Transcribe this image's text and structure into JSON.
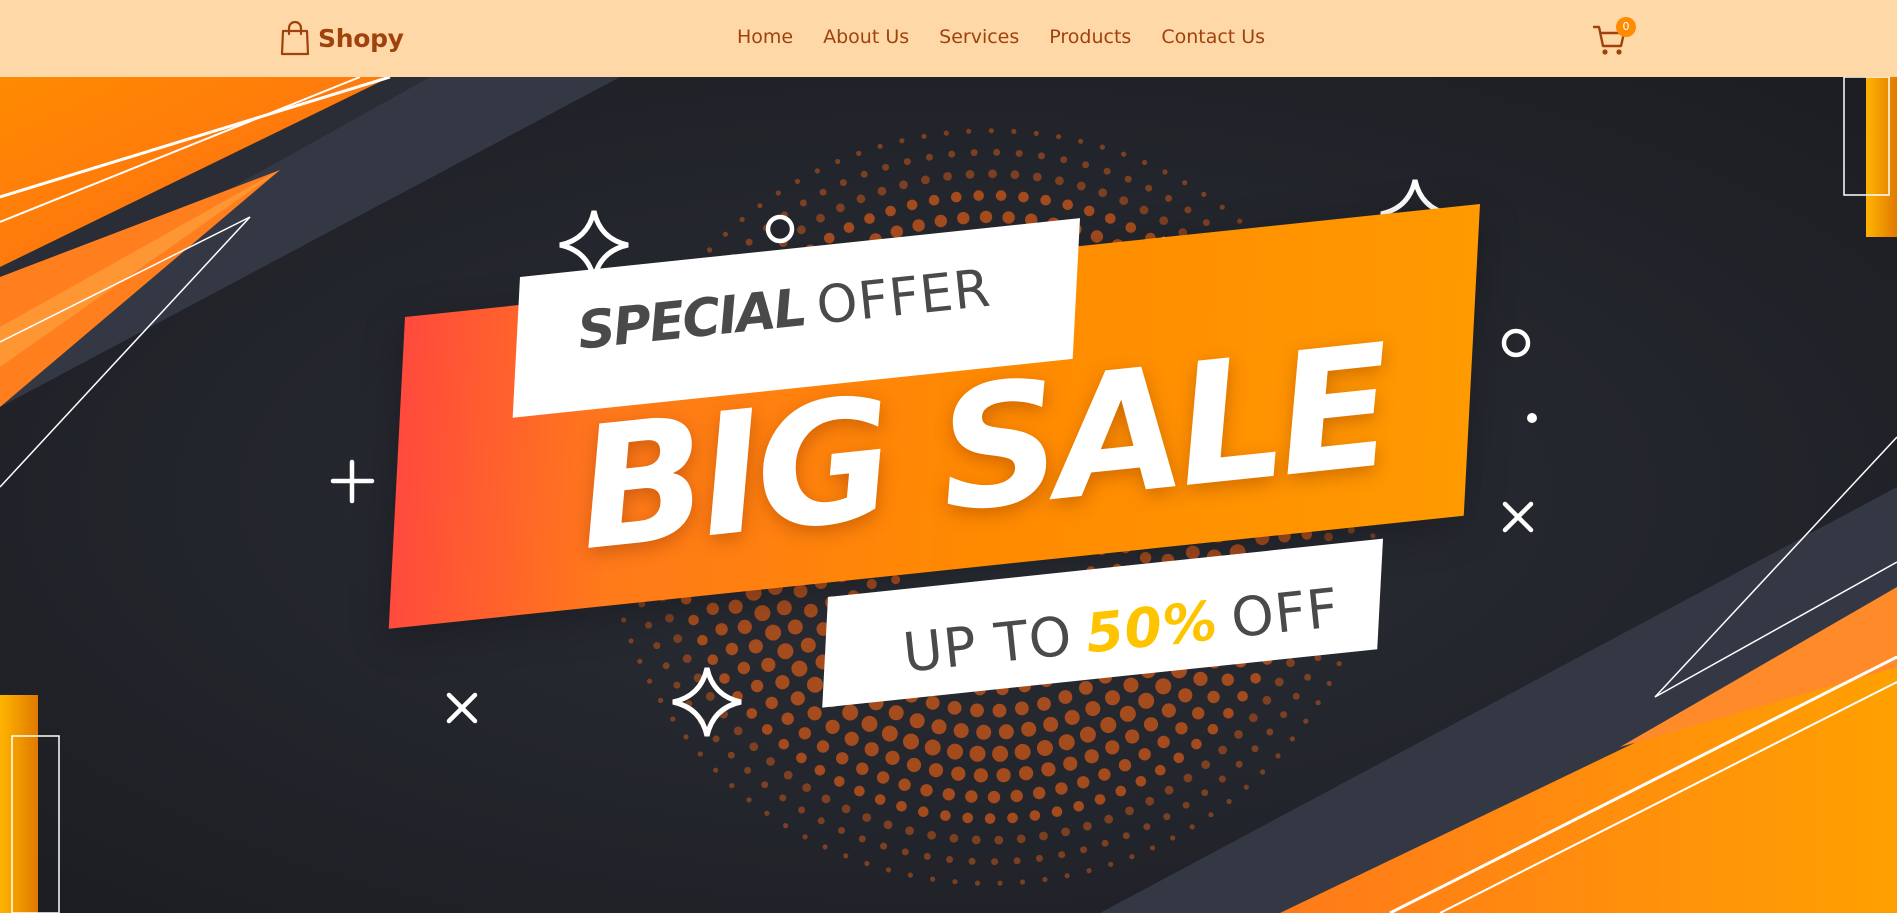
{
  "navbar": {
    "brand": {
      "name": "Shopy",
      "icon": "shopping-bag-icon"
    },
    "links": [
      {
        "label": "Home"
      },
      {
        "label": "About Us"
      },
      {
        "label": "Services"
      },
      {
        "label": "Products"
      },
      {
        "label": "Contact Us"
      }
    ],
    "cart": {
      "icon": "shopping-cart-icon",
      "count": "0"
    }
  },
  "hero": {
    "special_bold": "SPECIAL",
    "special_light": "OFFER",
    "headline": "BIG SALE",
    "upto_prefix": "UP TO",
    "discount": "50%",
    "upto_suffix": "OFF"
  },
  "colors": {
    "navbar_bg": "#ffd8a8",
    "brand_text": "#a0420d",
    "accent_orange": "#ff8a00",
    "accent_red": "#ff4a3d",
    "discount_yellow": "#ffc400",
    "hero_bg": "#23252c"
  }
}
